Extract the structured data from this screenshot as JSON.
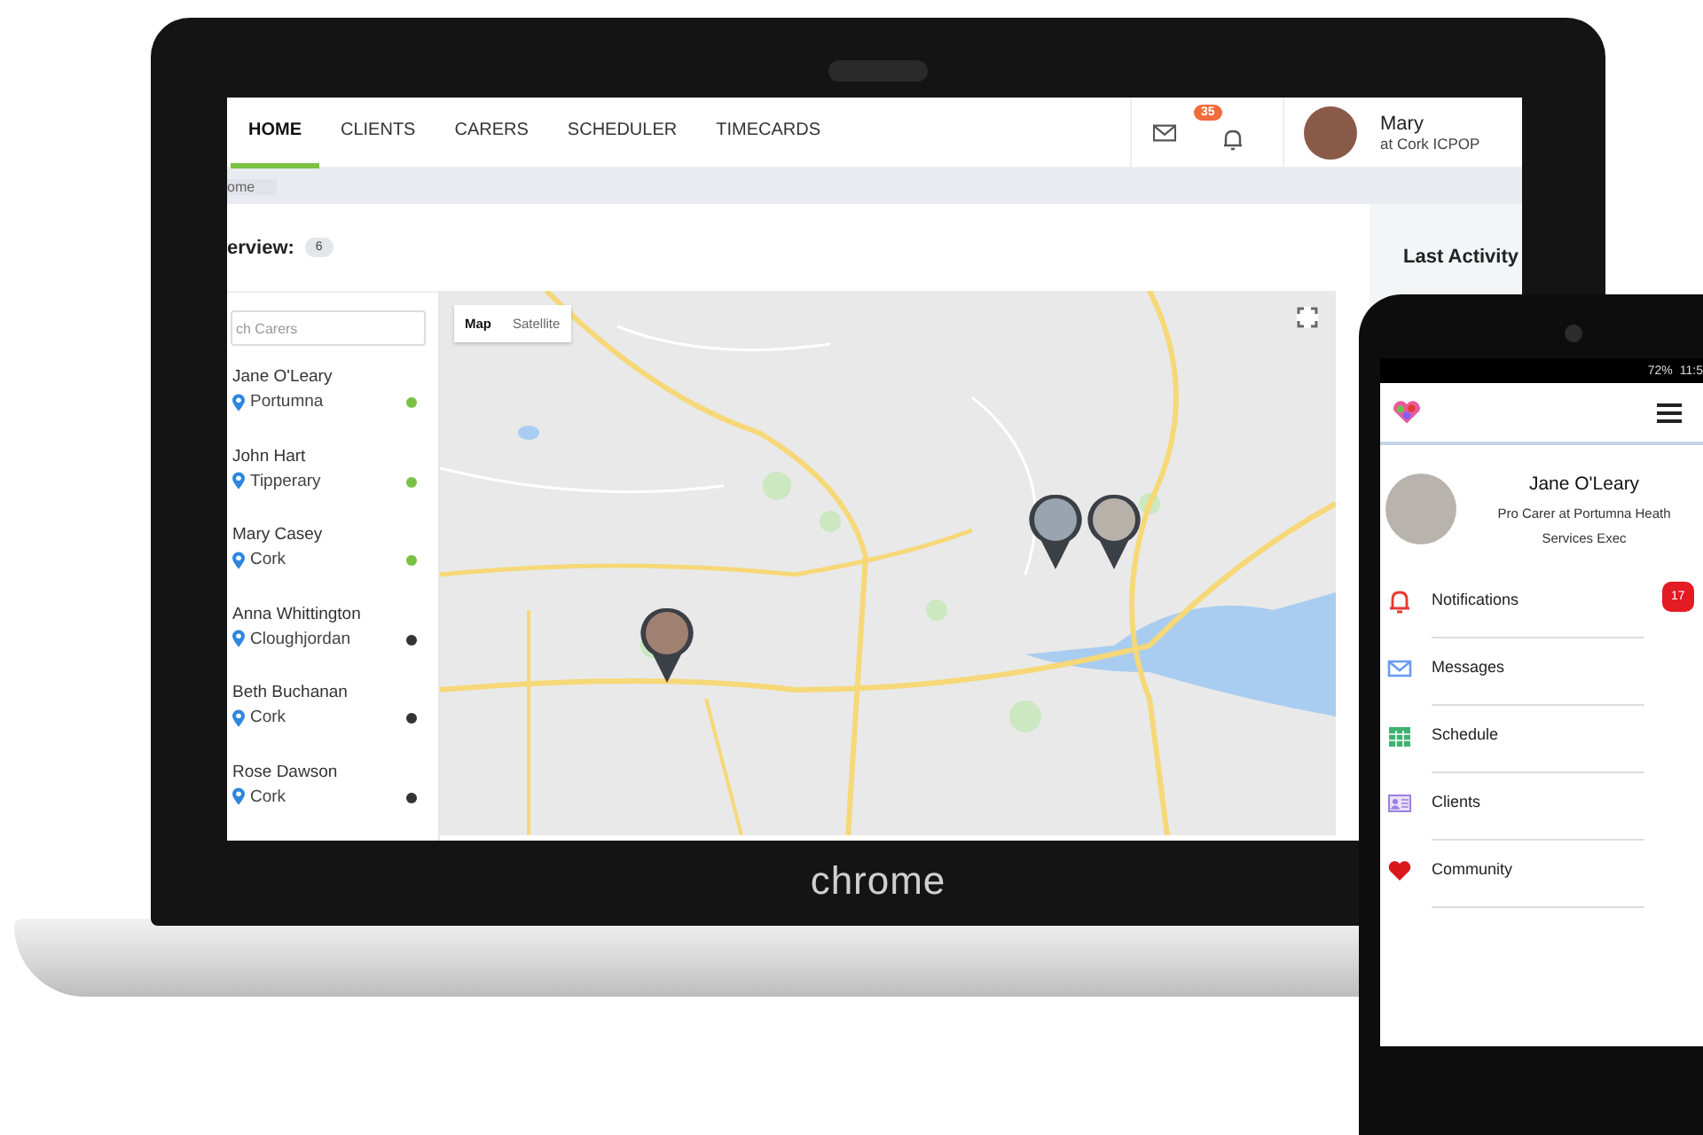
{
  "laptop": {
    "brand": "chrome",
    "nav": {
      "tabs": [
        {
          "label": "HOME",
          "selected": true
        },
        {
          "label": "CLIENTS",
          "selected": false
        },
        {
          "label": "CARERS",
          "selected": false
        },
        {
          "label": "SCHEDULER",
          "selected": false
        },
        {
          "label": "TIMECARDS",
          "selected": false
        }
      ],
      "notification_count": "35",
      "user": {
        "name": "Mary",
        "org": "at Cork ICPOP"
      }
    },
    "breadcrumb": "ome",
    "overview": {
      "title": "erview:",
      "count": "6"
    },
    "carers": {
      "search_placeholder": "ch Carers",
      "items": [
        {
          "name": "Jane O'Leary",
          "location": "Portumna",
          "online": true
        },
        {
          "name": "John Hart",
          "location": "Tipperary",
          "online": true
        },
        {
          "name": "Mary Casey",
          "location": "Cork",
          "online": true
        },
        {
          "name": "Anna Whittington",
          "location": "Cloughjordan",
          "online": false
        },
        {
          "name": "Beth Buchanan",
          "location": "Cork",
          "online": false
        },
        {
          "name": "Rose Dawson",
          "location": "Cork",
          "online": false
        }
      ]
    },
    "map": {
      "map_types": [
        {
          "label": "Map",
          "selected": true
        },
        {
          "label": "Satellite",
          "selected": false
        }
      ]
    },
    "side_panel": {
      "title": "Last Activity"
    }
  },
  "phone": {
    "status": {
      "battery": "72%",
      "time": "11:5"
    },
    "profile": {
      "name": "Jane O'Leary",
      "role": "Pro Carer at Portumna Heath Services Exec"
    },
    "menu": [
      {
        "label": "Notifications",
        "kind": "bell",
        "badge": "17"
      },
      {
        "label": "Messages",
        "kind": "mail"
      },
      {
        "label": "Schedule",
        "kind": "calendar"
      },
      {
        "label": "Clients",
        "kind": "card"
      },
      {
        "label": "Community",
        "kind": "heart"
      }
    ]
  }
}
